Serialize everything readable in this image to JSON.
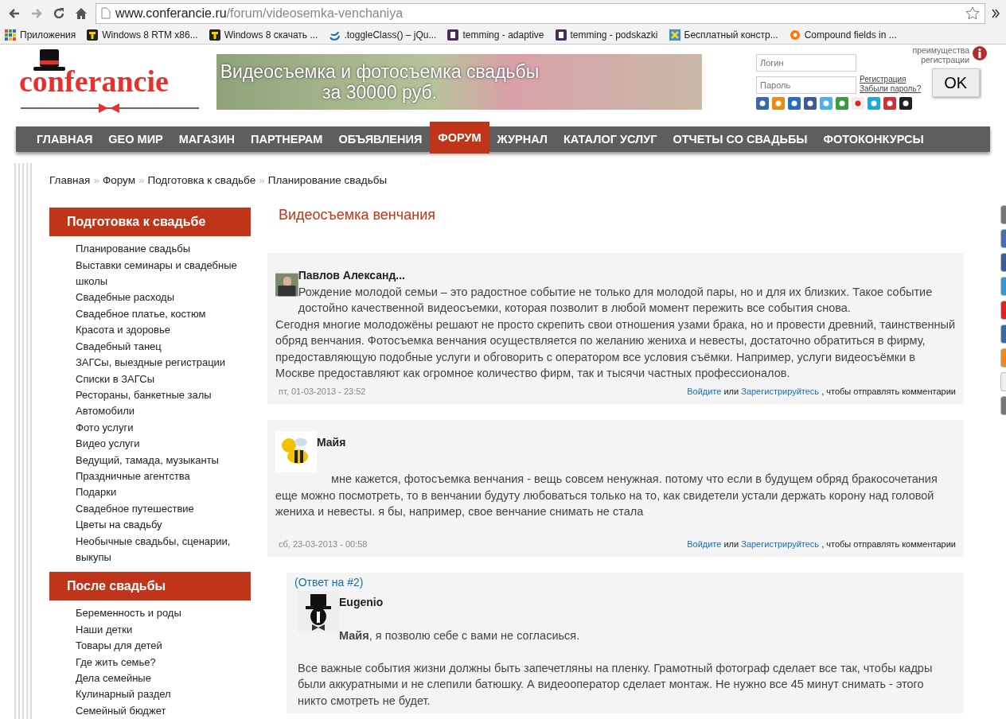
{
  "browser": {
    "url_host": "www.conferancie.ru",
    "url_path": "/forum/videosemka-venchaniya",
    "bookmarks": [
      {
        "label": "Приложения"
      },
      {
        "label": "Windows 8 RTM x86..."
      },
      {
        "label": "Windows 8 скачать ..."
      },
      {
        "label": ".toggleClass() – jQu..."
      },
      {
        "label": "temming - adaptive"
      },
      {
        "label": "temming - podskazki"
      },
      {
        "label": "Бесплатный констр..."
      },
      {
        "label": "Compound fields in ..."
      }
    ]
  },
  "header": {
    "logo": "conferancie",
    "banner": {
      "line1": "Видеосъемка и фотосъемка свадьбы",
      "line2": "за 30000 руб."
    },
    "login": {
      "login_placeholder": "Логин",
      "password_placeholder": "Пароль",
      "register": "Регистрация",
      "forgot": "Забыли пароль?",
      "submit": "OK",
      "benefits": "преимущества регистрации"
    }
  },
  "nav": [
    {
      "label": "ГЛАВНАЯ",
      "selected": false
    },
    {
      "label": "GEO МИР",
      "selected": false
    },
    {
      "label": "МАГАЗИН",
      "selected": false
    },
    {
      "label": "ПАРТНЕРАМ",
      "selected": false
    },
    {
      "label": "ОБЪЯВЛЕНИЯ",
      "selected": false
    },
    {
      "label": "ФОРУМ",
      "selected": true
    },
    {
      "label": "ЖУРНАЛ",
      "selected": false
    },
    {
      "label": "КАТАЛОГ УСЛУГ",
      "selected": false
    },
    {
      "label": "ОТЧЕТЫ СО СВАДЬБЫ",
      "selected": false
    },
    {
      "label": "ФОТОКОНКУРСЫ",
      "selected": false
    }
  ],
  "breadcrumb": [
    {
      "label": "Главная"
    },
    {
      "separator": "»",
      "label": "Форум"
    },
    {
      "separator": "»",
      "label": "Подготовка к свадьбе"
    },
    {
      "separator": "»",
      "label": "Планирование свадьбы"
    }
  ],
  "sidebar": [
    {
      "title": "Подготовка к свадьбе",
      "items": [
        "Планирование свадьбы",
        "Выставки семинары и свадебные школы",
        "Свадебные расходы",
        "Свадебное платье, костюм",
        "Красота и здоровье",
        "Свадебный танец",
        "ЗАГСы, выездные регистрации",
        "Списки в ЗАГСы",
        "Рестораны, банкетные залы",
        "Автомобили",
        "Фото услуги",
        "Видео услуги",
        "Ведущий, тамада, музыканты",
        "Праздничные агентства",
        "Подарки",
        "Свадебное путешествие",
        "Цветы на свадьбу",
        "Необычные свадьбы, сценарии, выкупы"
      ]
    },
    {
      "title": "После свадьбы",
      "items": [
        "Беременность и роды",
        "Наши детки",
        "Товары для детей",
        "Где жить семье?",
        "Дела семейные",
        "Кулинарный раздел",
        "Семейный бюджет"
      ]
    }
  ],
  "page_title": "Видеосъемка венчания",
  "comments": [
    {
      "kind": "photo",
      "author": "Павлов Александ...",
      "lead": "Рождение молодой семьи – это радостное событие не только для молодой пары, но и для их близких. Такое событие достойно качественной видеосъемки, которая позволит в любой момент пережить все события снова.",
      "paragraphs": [
        "Сегодня многие молодожёны решают не просто скрепить свои отношения узами брака, но и провести древний, таинственный обряд венчания. Фотосъемка венчания осуществляется по желанию жениха и невесты, достаточно обратиться в фирму, предоставляющую подобные услуги и обговорить с оператором все условия съёмки. Например, услуги видеосъёмки в Москве предоставляют как огромное количество фирм, так и тысячи частных профессионалов."
      ],
      "date": "пт, 01-03-2013 - 23:52",
      "login": "Войдите",
      "or": "или",
      "register": "Зарегистрируйтесь",
      "tail": ", чтобы отправлять комментарии"
    },
    {
      "kind": "bee",
      "author": "Майя",
      "paragraphs": [
        "мне кажется, фотосъемка венчания - вещь совсем ненужная. потому что если в будущем обряд бракосочетания еще можно посмотреть, то в венчании будуту любоваться только на то, как свидетели устали держать корону над головой жениха и невесты. я бы, например, свое венчание снимать не стала"
      ],
      "date": "сб, 23-03-2013 - 00:58",
      "login": "Войдите",
      "or": "или",
      "register": "Зарегистрируйтесь",
      "tail": ", чтобы отправлять комментарии"
    },
    {
      "kind": "hat",
      "reply_to": "(Ответ на #2)",
      "author": "Eugenio",
      "lead": "**Майя**, я позволю себе с вами не согласиься.",
      "paragraphs": [
        "Все важные события жизни должны быть запечетляны на пленку. Грамотный фотограф сделает все так, чтобы кадры были аккуратными и не слепили батюшку. А видеооператор сделает монтаж. Не нужно все 45 минут снимать - этого никто смотреть не будет."
      ]
    }
  ]
}
